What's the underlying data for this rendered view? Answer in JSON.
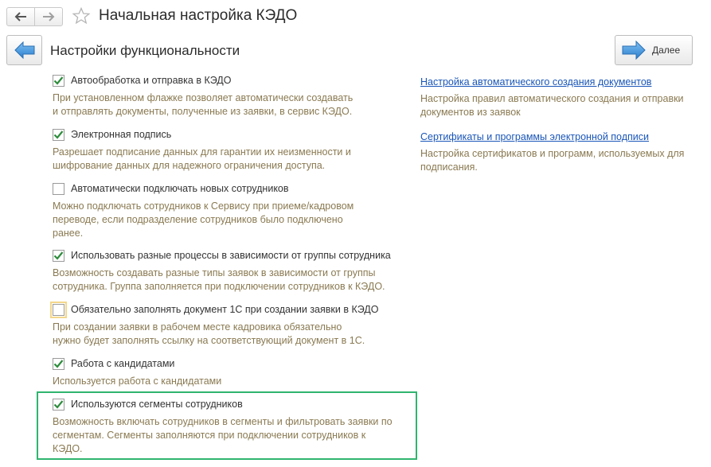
{
  "window": {
    "title": "Начальная настройка КЭДО"
  },
  "header": {
    "page_title": "Настройки функциональности",
    "next_label": "Далее"
  },
  "options": [
    {
      "label": "Автообработка и отправка в КЭДО",
      "checked": true,
      "desc": "При установленном флажке позволяет автоматически создавать\nи отправлять документы, полученные из заявки, в сервис КЭДО."
    },
    {
      "label": "Электронная подпись",
      "checked": true,
      "desc": "Разрешает подписание данных для гарантии их неизменности и\nшифрование данных для надежного ограничения доступа."
    },
    {
      "label": "Автоматически подключать новых сотрудников",
      "checked": false,
      "desc": "Можно подключать сотрудников к Сервису при приеме/кадровом\nпереводе, если подразделение сотрудников было подключено\nранее."
    },
    {
      "label": "Использовать разные процессы в зависимости от группы сотрудника",
      "checked": true,
      "desc": "Возможность создавать разные типы заявок в зависимости от группы\nсотрудника. Группа заполняется при подключении сотрудников к КЭДО."
    },
    {
      "label": "Обязательно заполнять документ 1С при создании заявки в КЭДО",
      "checked": false,
      "desc": "При создании заявки в рабочем месте кадровика обязательно\nнужно будет заполнять ссылку на соответствующий документ в 1С."
    },
    {
      "label": "Работа с кандидатами",
      "checked": true,
      "desc": "Используется работа с кандидатами"
    },
    {
      "label": "Используются сегменты сотрудников",
      "checked": true,
      "desc": "Возможность включать сотрудников в сегменты и фильтровать заявки по\nсегментам. Сегменты заполняются при подключении сотрудников к\nКЭДО."
    }
  ],
  "links": [
    {
      "label": "Настройка автоматического создания документов",
      "desc": "Настройка правил автоматического создания и отправки\nдокументов из заявок"
    },
    {
      "label": "Сертификаты и программы электронной подписи",
      "desc": "Настройка сертификатов и программ, используемых для\nподписания."
    }
  ],
  "colors": {
    "accent_arrow": "#3b8fd6",
    "link": "#1a56b8",
    "description": "#8a7a52",
    "highlight": "#2fb56e",
    "checkmark": "#2d8c3c"
  }
}
